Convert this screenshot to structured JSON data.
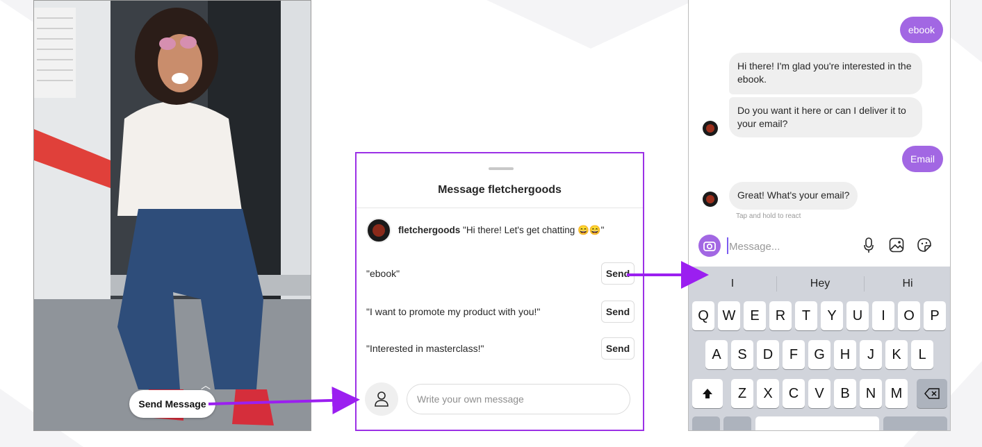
{
  "colors": {
    "accent_purple": "#9b30e6",
    "bubble_purple": "#a267e3",
    "bubble_gray": "#efefef",
    "keyboard_bg": "#d1d4db"
  },
  "left_panel": {
    "send_message_label": "Send Message"
  },
  "middle_panel": {
    "title": "Message fletchergoods",
    "username": "fletchergoods",
    "greeting": "\"Hi there! Let's get chatting 😄😄\"",
    "quick_replies": [
      {
        "text": "\"ebook\"",
        "send_label": "Send"
      },
      {
        "text": "\"I want to promote my product with you!\"",
        "send_label": "Send"
      },
      {
        "text": "\"Interested in masterclass!\"",
        "send_label": "Send"
      }
    ],
    "own_message_placeholder": "Write your own message"
  },
  "right_panel": {
    "messages": [
      {
        "from": "me",
        "text": "ebook"
      },
      {
        "from": "them",
        "text": "Hi there! I'm glad you're interested in the ebook."
      },
      {
        "from": "them",
        "text": "Do you want it here or can I deliver it to your email?"
      },
      {
        "from": "me",
        "text": "Email"
      },
      {
        "from": "them",
        "text": "Great! What's your email?"
      }
    ],
    "react_hint": "Tap and hold to react",
    "message_placeholder": "Message...",
    "icons": [
      "camera-icon",
      "microphone-icon",
      "gallery-icon",
      "sticker-icon"
    ],
    "keyboard": {
      "predictions": [
        "I",
        "Hey",
        "Hi"
      ],
      "row1": [
        "Q",
        "W",
        "E",
        "R",
        "T",
        "Y",
        "U",
        "I",
        "O",
        "P"
      ],
      "row2": [
        "A",
        "S",
        "D",
        "F",
        "G",
        "H",
        "J",
        "K",
        "L"
      ],
      "row3": [
        "Z",
        "X",
        "C",
        "V",
        "B",
        "N",
        "M"
      ]
    }
  }
}
